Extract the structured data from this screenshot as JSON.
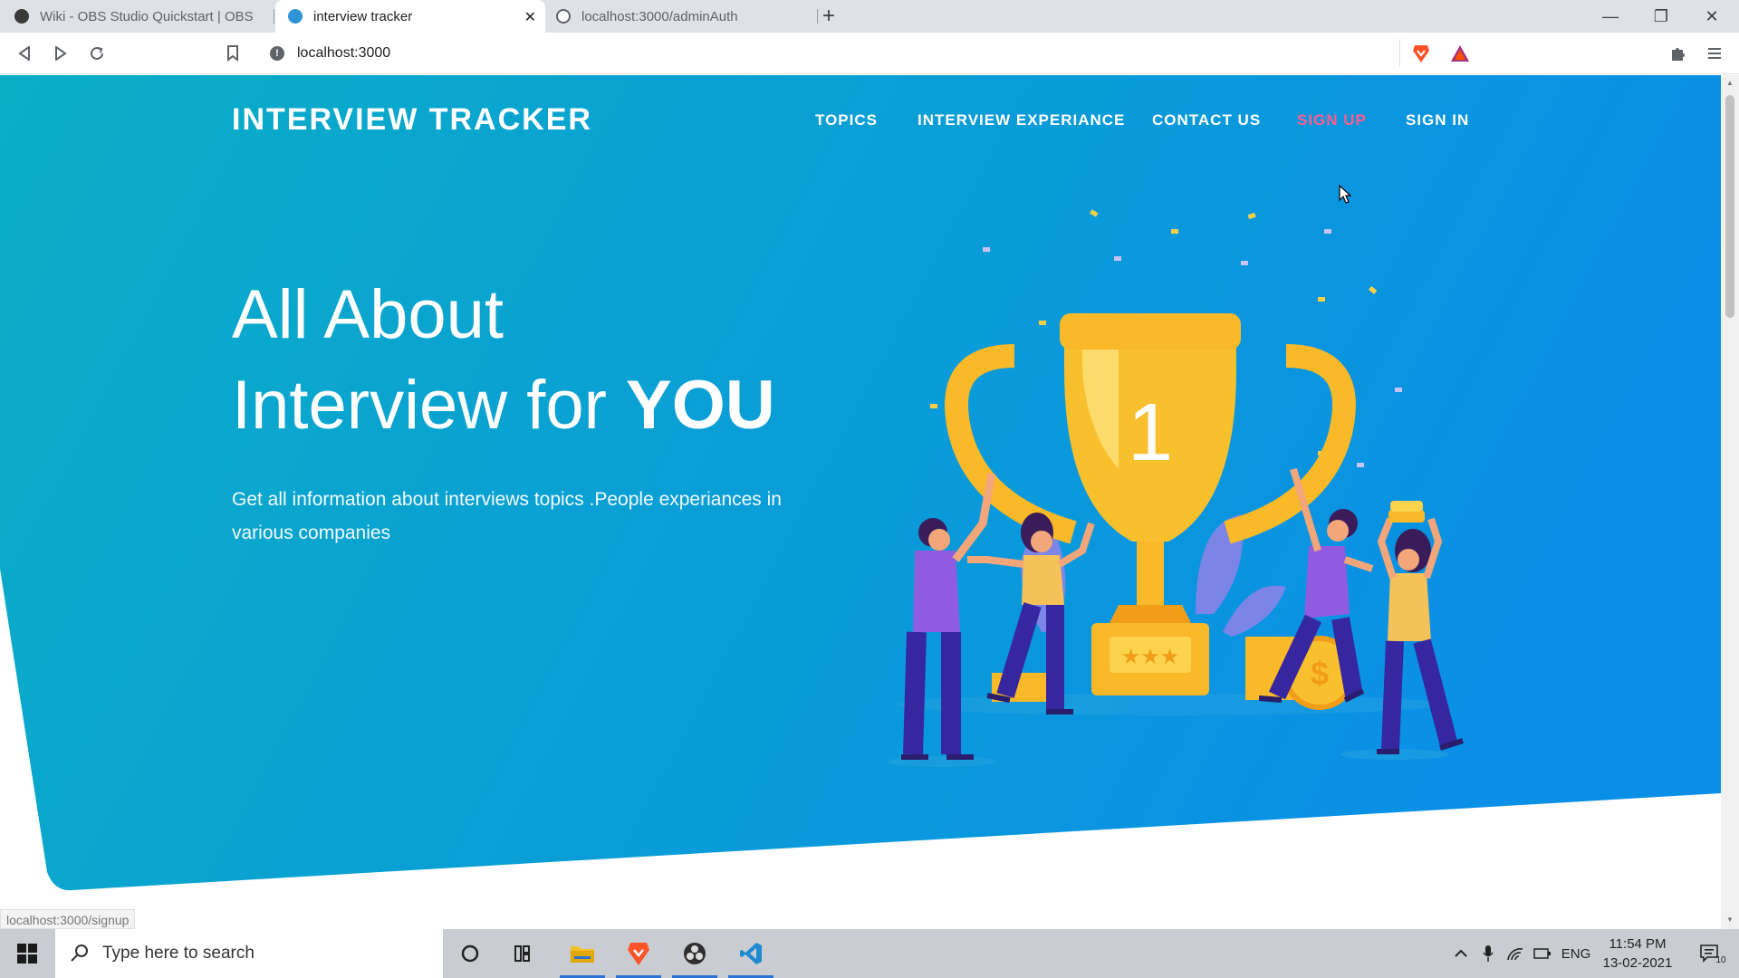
{
  "browser": {
    "tabs": [
      {
        "title": "Wiki - OBS Studio Quickstart | OBS",
        "active": false
      },
      {
        "title": "interview tracker",
        "active": true
      },
      {
        "title": "localhost:3000/adminAuth",
        "active": false
      }
    ],
    "close_glyph": "✕",
    "new_tab_glyph": "+",
    "address": "localhost:3000",
    "controls": {
      "minimize": "—",
      "maximize": "❐",
      "close": "✕"
    }
  },
  "site": {
    "brand": "INTERVIEW TRACKER",
    "nav": [
      {
        "label": "TOPICS",
        "active": false
      },
      {
        "label": "INTERVIEW EXPERIANCE",
        "active": false
      },
      {
        "label": "CONTACT US",
        "active": false
      },
      {
        "label": "SIGN UP",
        "active": true
      },
      {
        "label": "SIGN IN",
        "active": false
      }
    ],
    "headline_line1": "All About",
    "headline_line2_prefix": "Interview for ",
    "headline_emphasis": "YOU",
    "subtext": "Get all information about interviews topics .People experiances in various companies",
    "trophy_number": "1",
    "colors": {
      "hero_start": "#0aaec5",
      "hero_end": "#0a8fe6",
      "active_nav": "#ff5d8f",
      "trophy": "#f9b928"
    }
  },
  "status_bar": {
    "link": "localhost:3000/signup"
  },
  "taskbar": {
    "search_placeholder": "Type here to search",
    "language": "ENG",
    "time": "11:54 PM",
    "date": "13-02-2021",
    "notification_count": "10"
  }
}
